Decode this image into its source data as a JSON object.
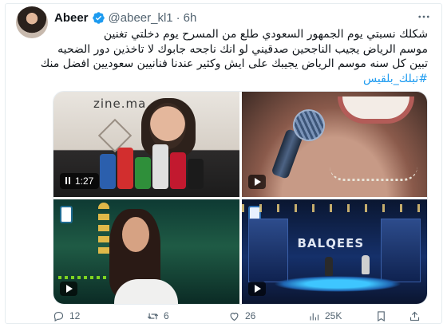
{
  "tweet": {
    "author_name": "Abeer",
    "handle": "@abeer_kl1",
    "separator": "·",
    "time": "6h",
    "text_lines": [
      "شكلك نسبتي يوم الجمهور السعودي طلع من المسرح يوم دخلتي تغنين",
      "موسم الرياض يجيب الناجحين صدقيني لو انك ناجحه جابوك لا تاخذين دور الضحيه",
      "تبين كل سنه موسم الرياض يجيبك على ايش وكثير عندنا فنانيين سعوديين افضل منك"
    ],
    "hashtag": "#تبلك_بلقيس"
  },
  "media": {
    "video_duration": "1:27",
    "watermark": "zine.ma",
    "stage_text": "BALQEES"
  },
  "actions": {
    "replies": "12",
    "retweets": "6",
    "likes": "26",
    "views": "25K"
  },
  "colors": {
    "accent": "#1d9bf0",
    "text": "#0f1419",
    "muted": "#536471",
    "verified": "#1d9bf0"
  },
  "icons": {
    "verified": "verified-badge-icon",
    "more": "more-icon",
    "reply": "reply-icon",
    "retweet": "retweet-icon",
    "like": "heart-icon",
    "views": "views-icon",
    "bookmark": "bookmark-icon",
    "share": "share-icon"
  }
}
